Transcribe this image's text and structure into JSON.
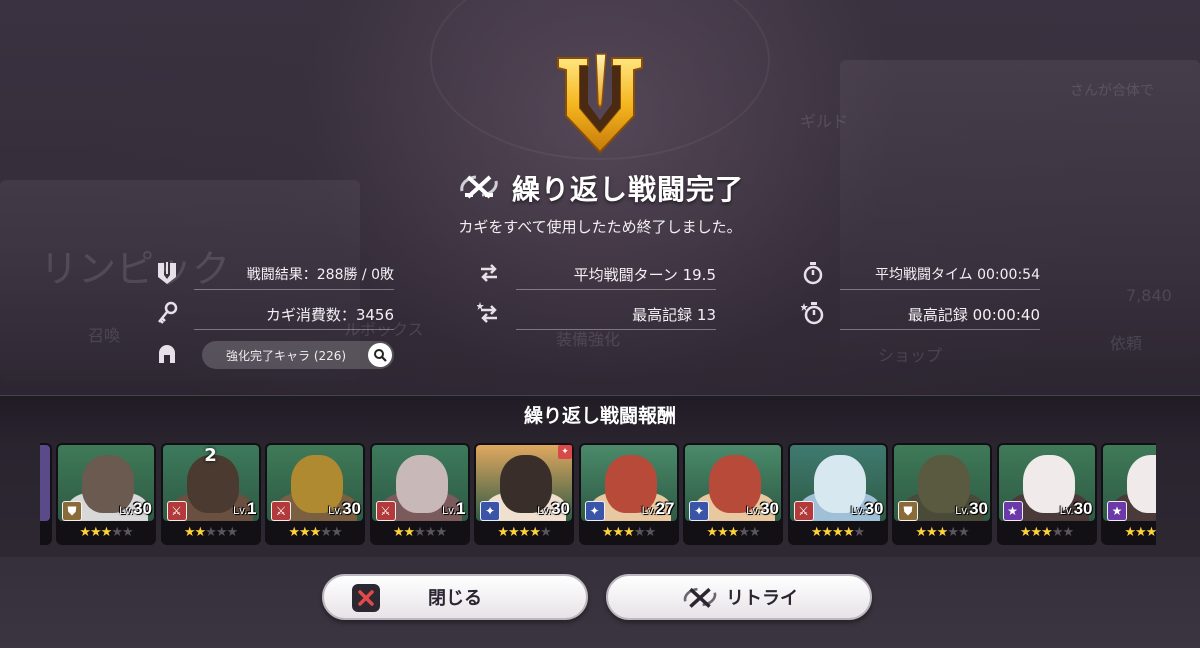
{
  "title": "繰り返し戦闘完了",
  "subtitle": "カギをすべて使用したため終了しました。",
  "stats": {
    "battle_result": "戦闘結果：288勝 / 0敗",
    "key_consumption": "カギ消費数：3456",
    "avg_turns": "平均戦闘ターン 19.5",
    "best_turns": "最高記録 13",
    "avg_time": "平均戦闘タイム 00:00:54",
    "best_time": "最高記録 00:00:40",
    "enhanced_chars": "強化完了キャラ (226)"
  },
  "reward_title": "繰り返し戦闘報酬",
  "rewards": [
    {
      "level_prefix": "Lv.",
      "level": "30",
      "role": "shield",
      "stars": 3,
      "count": ""
    },
    {
      "level_prefix": "Lv.",
      "level": "1",
      "role": "sword",
      "stars": 2,
      "count": "2"
    },
    {
      "level_prefix": "Lv.",
      "level": "30",
      "role": "sword",
      "stars": 3,
      "count": ""
    },
    {
      "level_prefix": "Lv.",
      "level": "1",
      "role": "sword",
      "stars": 2,
      "count": ""
    },
    {
      "level_prefix": "Lv.",
      "level": "30",
      "role": "mage",
      "stars": 4,
      "count": ""
    },
    {
      "level_prefix": "Lv.",
      "level": "27",
      "role": "mage",
      "stars": 3,
      "count": ""
    },
    {
      "level_prefix": "Lv.",
      "level": "30",
      "role": "mage",
      "stars": 3,
      "count": ""
    },
    {
      "level_prefix": "Lv.",
      "level": "30",
      "role": "sword",
      "stars": 4,
      "count": ""
    },
    {
      "level_prefix": "Lv.",
      "level": "30",
      "role": "shield",
      "stars": 3,
      "count": ""
    },
    {
      "level_prefix": "Lv.",
      "level": "30",
      "role": "star",
      "stars": 3,
      "count": ""
    },
    {
      "level_prefix": "",
      "level": "",
      "role": "star",
      "stars": 3,
      "count": ""
    }
  ],
  "buttons": {
    "close": "閉じる",
    "retry": "リトライ"
  },
  "background_text": {
    "olympic": "リンピック",
    "summon": "召喚",
    "box": "ルボックス",
    "equip": "装備強化",
    "shop": "ショップ",
    "request": "依頼",
    "guild": "ギルド",
    "currency": "7,840",
    "notice": "さんが合体で"
  },
  "colors": {
    "accent_gold": "#f5c02e",
    "role_shield": "#8a6b3a",
    "role_sword": "#b23a3a",
    "role_mage": "#3a55a8",
    "role_star": "#6b3aa8"
  }
}
